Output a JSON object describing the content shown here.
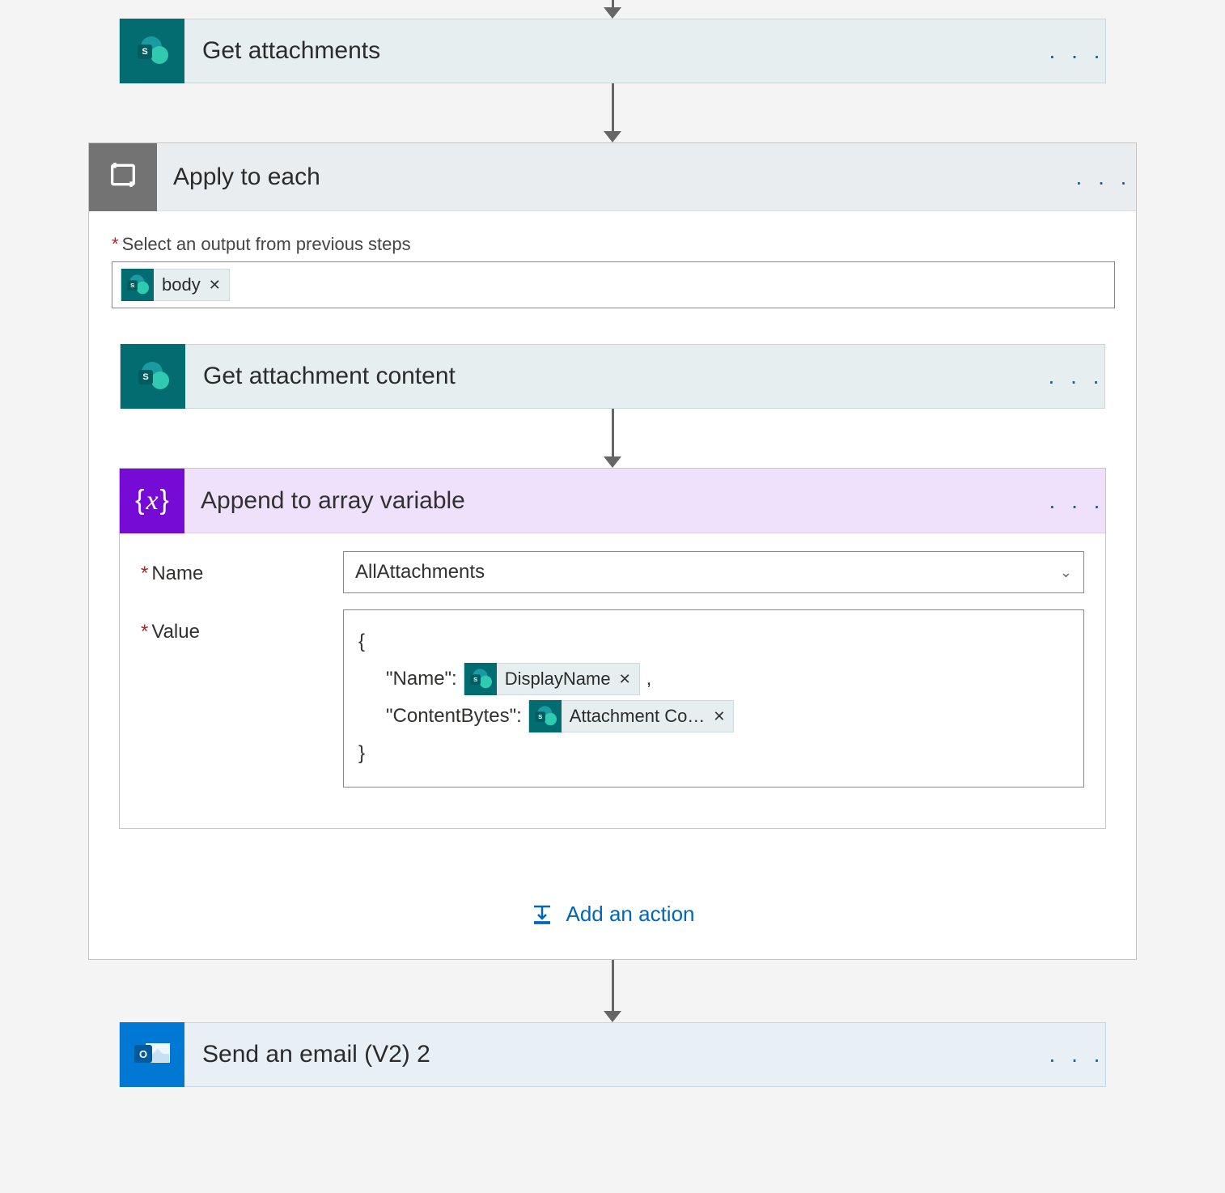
{
  "step1": {
    "title": "Get attachments"
  },
  "applyToEach": {
    "title": "Apply to each",
    "selectLabel": "Select an output from previous steps",
    "bodyToken": "body"
  },
  "innerStep1": {
    "title": "Get attachment content"
  },
  "appendVar": {
    "title": "Append to array variable",
    "nameLabel": "Name",
    "nameValue": "AllAttachments",
    "valueLabel": "Value",
    "code": {
      "open": "{",
      "nameKey": "\"Name\":",
      "displayToken": "DisplayName",
      "comma": ",",
      "cbKey": "\"ContentBytes\":",
      "attachToken": "Attachment Co…",
      "close": "}"
    }
  },
  "addAction": "Add an action",
  "step3": {
    "title": "Send an email (V2) 2"
  },
  "menuGlyph": ". . ."
}
